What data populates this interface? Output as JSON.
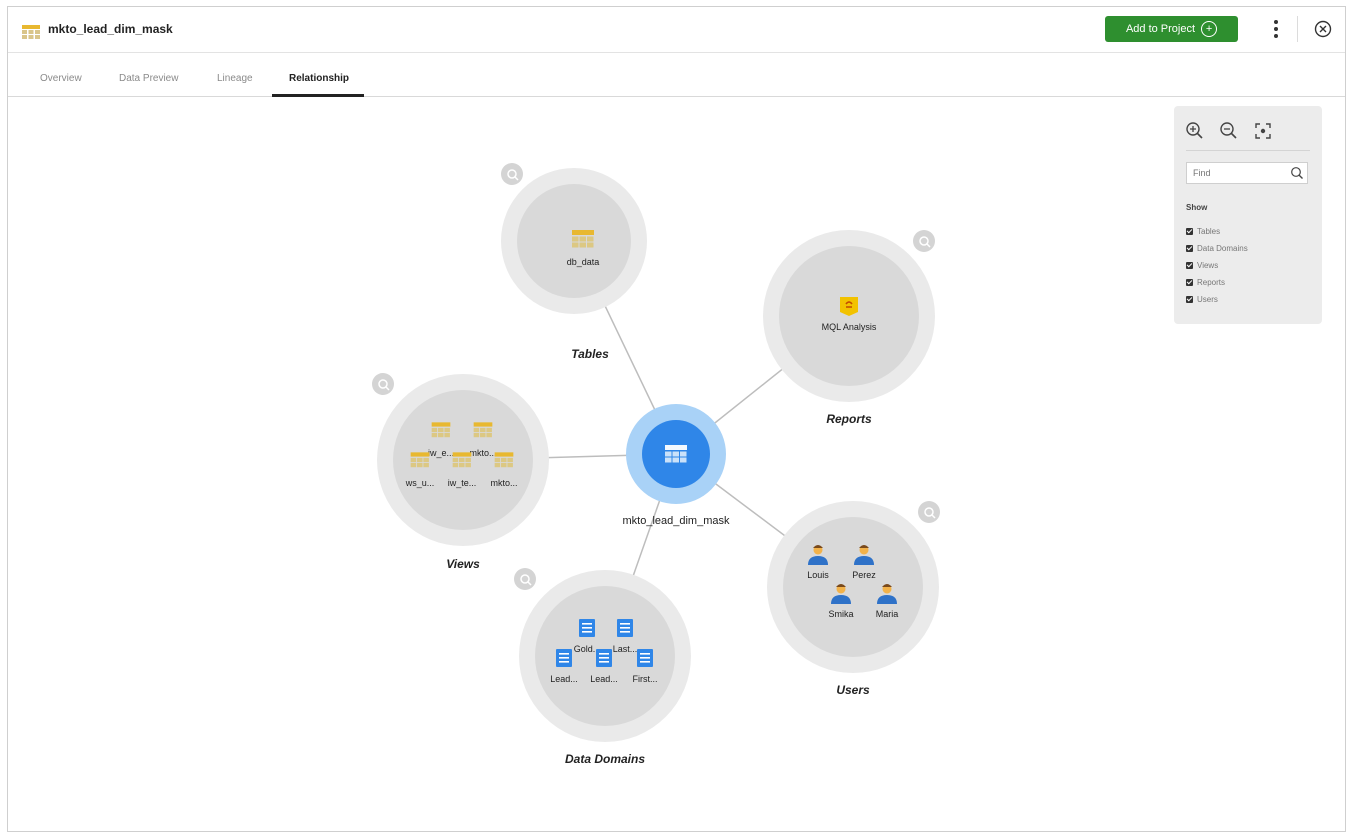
{
  "header": {
    "title": "mkto_lead_dim_mask",
    "add_button_label": "Add to Project",
    "add_button_color": "#2e8f2f"
  },
  "tabs": [
    {
      "label": "Overview",
      "active": false
    },
    {
      "label": "Data Preview",
      "active": false
    },
    {
      "label": "Lineage",
      "active": false
    },
    {
      "label": "Relationship",
      "active": true
    }
  ],
  "graph": {
    "center": {
      "label": "mkto_lead_dim_mask",
      "icon": "table-icon",
      "color": "#2f86e8"
    },
    "groups": [
      {
        "id": "tables",
        "label": "Tables",
        "items": [
          {
            "label": "db_data",
            "icon": "table-icon"
          }
        ]
      },
      {
        "id": "reports",
        "label": "Reports",
        "items": [
          {
            "label": "MQL Analysis",
            "icon": "report-icon"
          }
        ]
      },
      {
        "id": "views",
        "label": "Views",
        "items": [
          {
            "label": "iw_e...",
            "icon": "view-icon"
          },
          {
            "label": "mkto...",
            "icon": "view-icon"
          },
          {
            "label": "ws_u...",
            "icon": "view-icon"
          },
          {
            "label": "iw_te...",
            "icon": "view-icon"
          },
          {
            "label": "mkto...",
            "icon": "view-icon"
          }
        ]
      },
      {
        "id": "domains",
        "label": "Data Domains",
        "items": [
          {
            "label": "Gold...",
            "icon": "domain-icon"
          },
          {
            "label": "Last...",
            "icon": "domain-icon"
          },
          {
            "label": "Lead...",
            "icon": "domain-icon"
          },
          {
            "label": "Lead...",
            "icon": "domain-icon"
          },
          {
            "label": "First...",
            "icon": "domain-icon"
          }
        ]
      },
      {
        "id": "users",
        "label": "Users",
        "items": [
          {
            "label": "Louis",
            "icon": "user-icon"
          },
          {
            "label": "Perez",
            "icon": "user-icon"
          },
          {
            "label": "Smika",
            "icon": "user-icon"
          },
          {
            "label": "Maria",
            "icon": "user-icon"
          }
        ]
      }
    ]
  },
  "panel": {
    "find_placeholder": "Find",
    "show_label": "Show",
    "filters": [
      {
        "label": "Tables",
        "checked": true
      },
      {
        "label": "Data Domains",
        "checked": true
      },
      {
        "label": "Views",
        "checked": true
      },
      {
        "label": "Reports",
        "checked": true
      },
      {
        "label": "Users",
        "checked": true
      }
    ]
  }
}
